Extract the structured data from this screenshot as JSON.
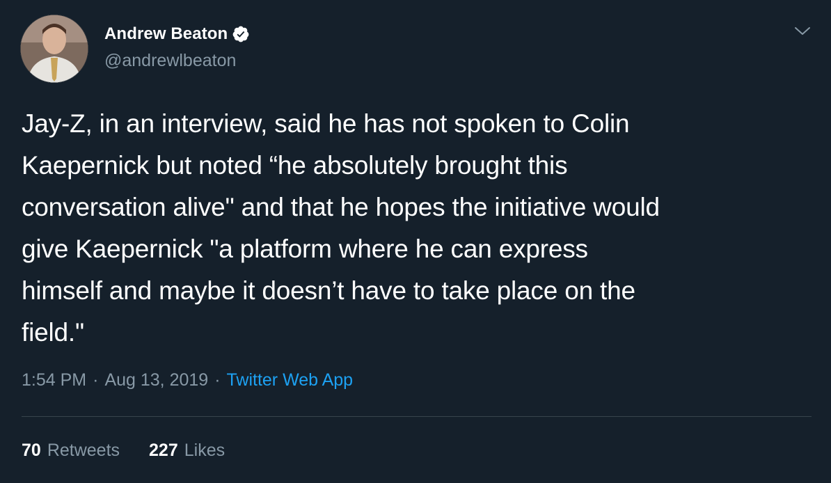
{
  "author": {
    "display_name": "Andrew Beaton",
    "handle": "@andrewlbeaton",
    "verified_icon": "verified-badge-icon",
    "avatar_icon": "avatar-photo"
  },
  "menu": {
    "icon": "chevron-down-icon"
  },
  "tweet": {
    "text": "Jay-Z, in an interview, said he has not spoken to Colin\nKaepernick but noted “he absolutely brought this\nconversation alive\" and that he hopes the initiative would\ngive Kaepernick \"a platform where he can express\nhimself and maybe it doesn’t have to take place on the\nfield.\""
  },
  "meta": {
    "time": "1:54 PM",
    "separator": "·",
    "date": "Aug 13, 2019",
    "source": "Twitter Web App"
  },
  "stats": {
    "retweets_count": "70",
    "retweets_label": "Retweets",
    "likes_count": "227",
    "likes_label": "Likes"
  },
  "colors": {
    "background": "#15202b",
    "primary_text": "#ffffff",
    "secondary_text": "#8899a6",
    "accent": "#1da1f2",
    "divider": "#38444d"
  }
}
